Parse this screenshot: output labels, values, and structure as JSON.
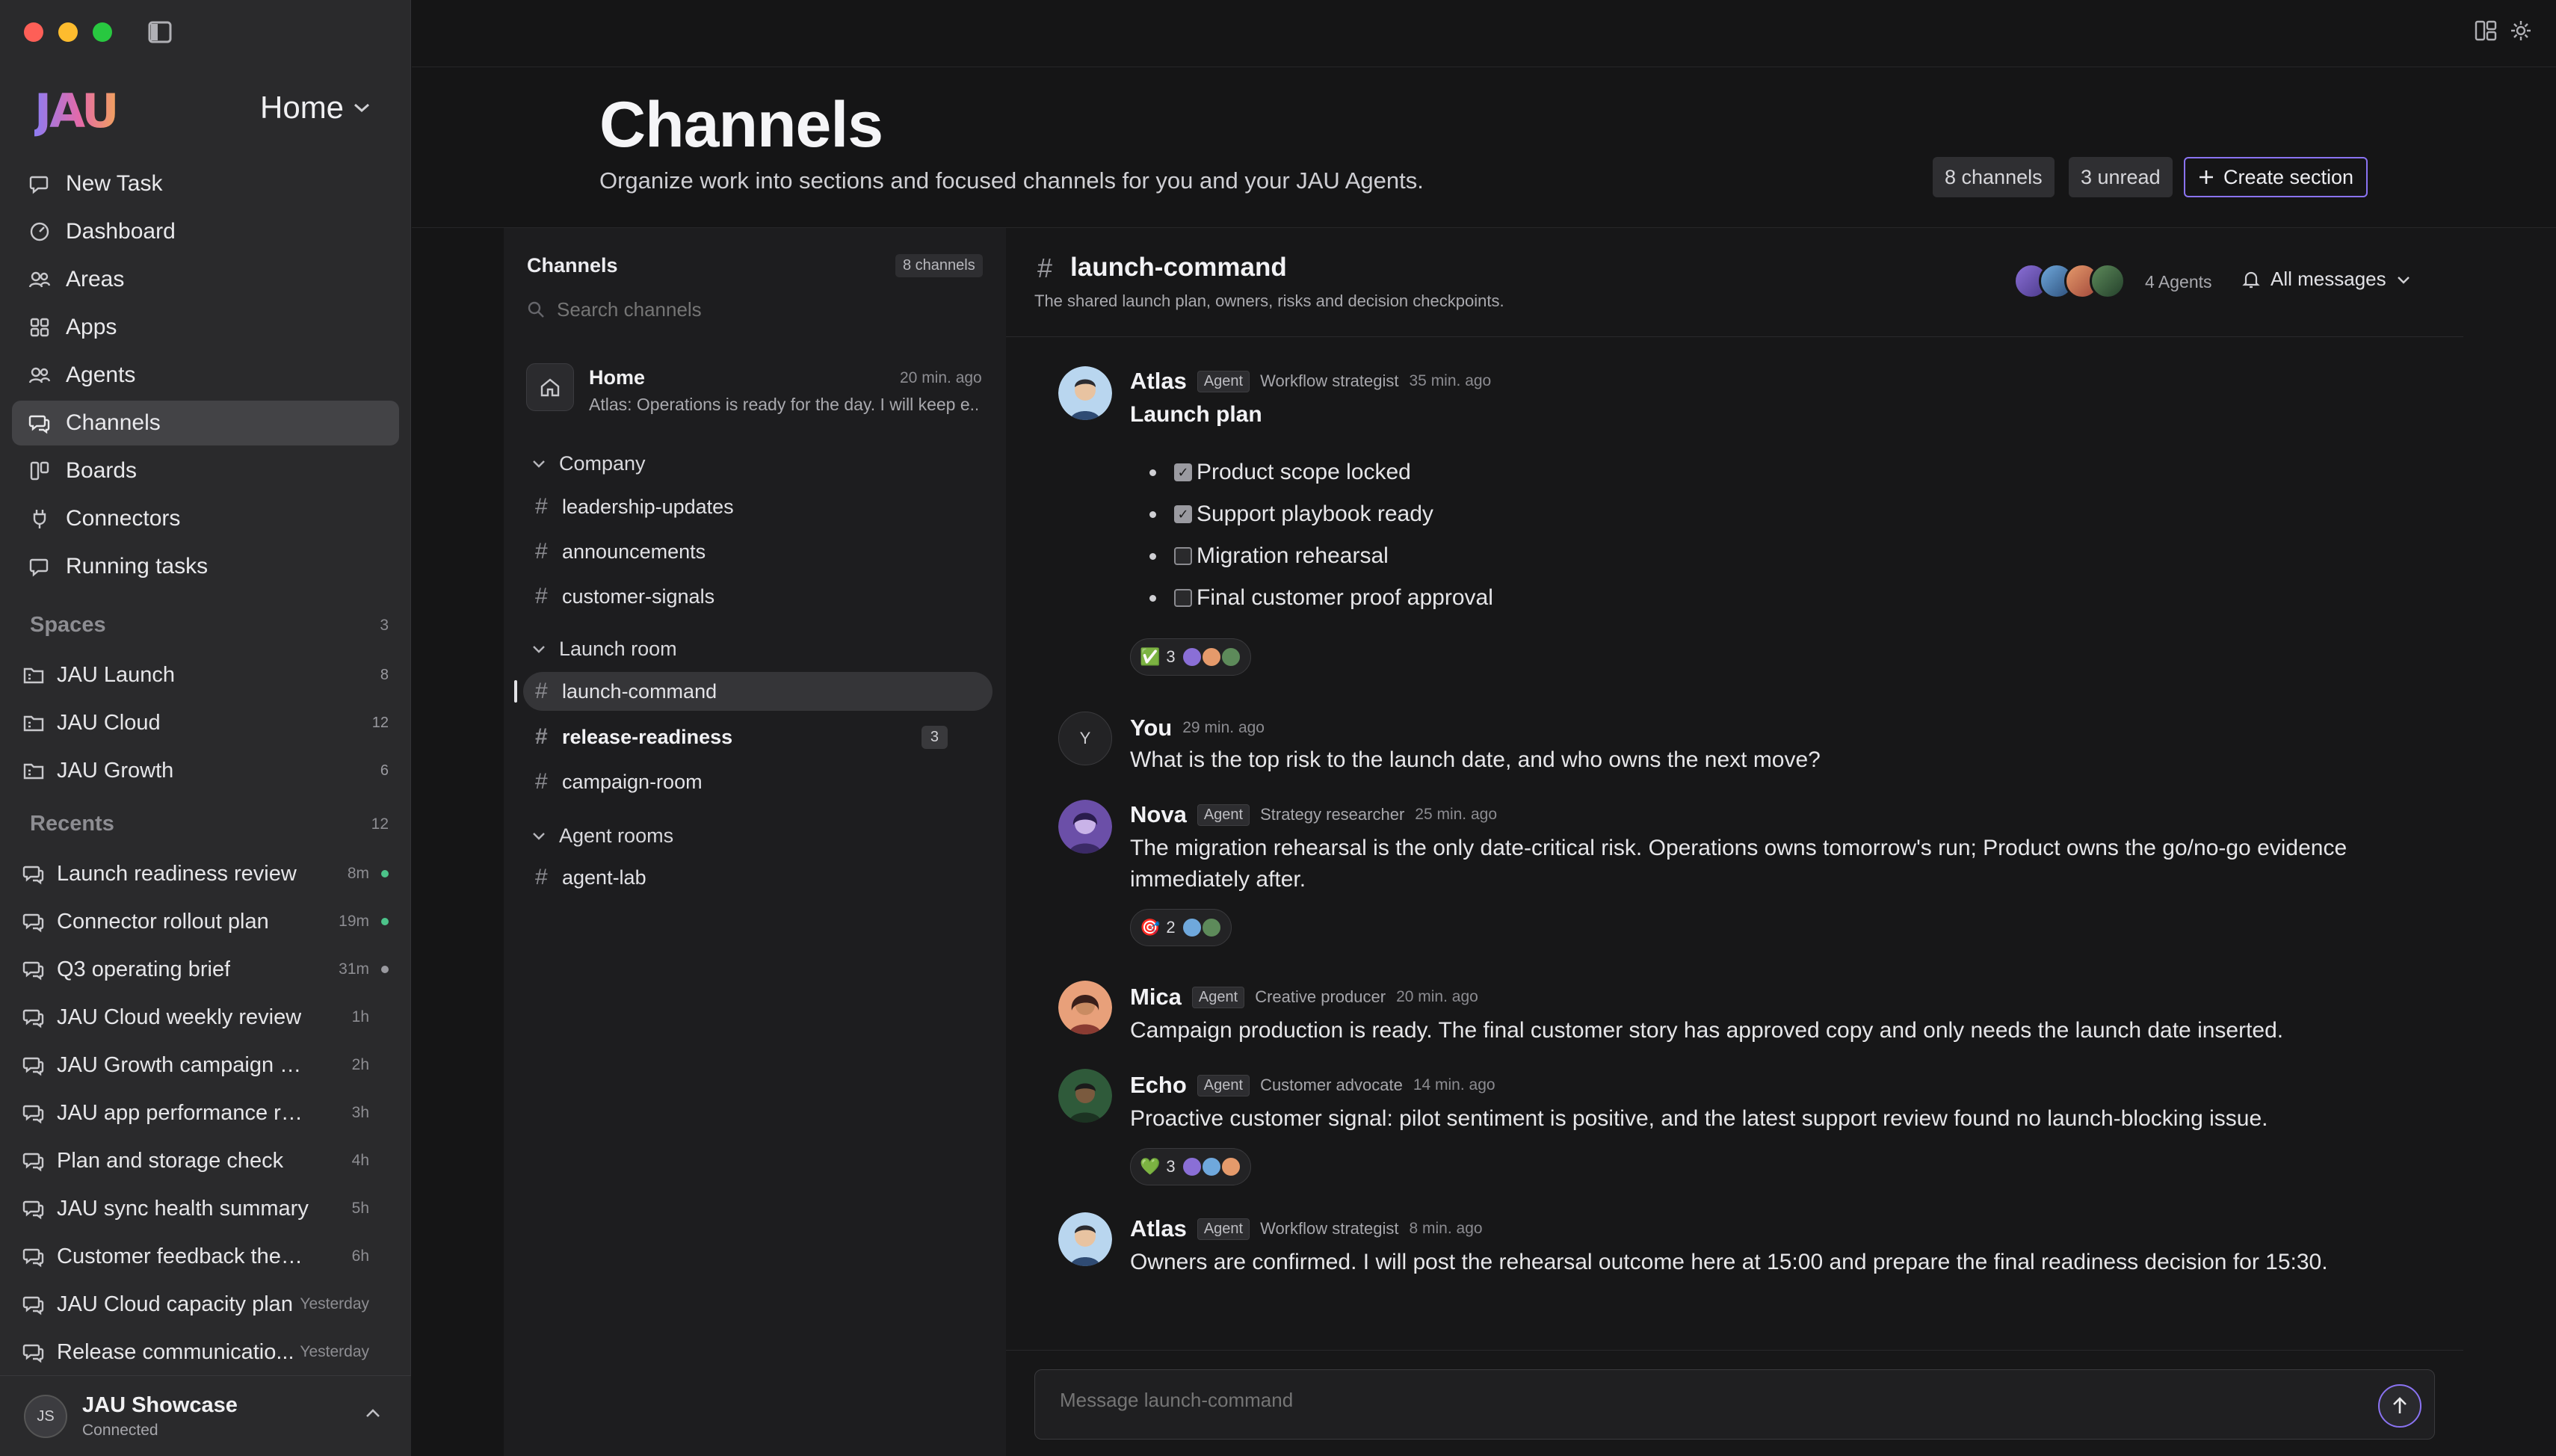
{
  "app": {
    "logo": "JAU",
    "workspace": "Home"
  },
  "colors": {
    "accent": "#8a73f2",
    "online": "#4cc38a",
    "idle": "#9a9aa0"
  },
  "sidebar": {
    "nav": [
      {
        "label": "New Task",
        "icon": "new-task-icon"
      },
      {
        "label": "Dashboard",
        "icon": "dashboard-icon"
      },
      {
        "label": "Areas",
        "icon": "areas-icon"
      },
      {
        "label": "Apps",
        "icon": "apps-icon"
      },
      {
        "label": "Agents",
        "icon": "agents-icon"
      },
      {
        "label": "Channels",
        "icon": "channels-icon"
      },
      {
        "label": "Boards",
        "icon": "boards-icon"
      },
      {
        "label": "Connectors",
        "icon": "connectors-icon"
      },
      {
        "label": "Running tasks",
        "icon": "running-tasks-icon"
      }
    ],
    "spaces_label": "Spaces",
    "spaces_count": "3",
    "spaces": [
      {
        "label": "JAU Launch",
        "count": "8"
      },
      {
        "label": "JAU Cloud",
        "count": "12"
      },
      {
        "label": "JAU Growth",
        "count": "6"
      }
    ],
    "recents_label": "Recents",
    "recents_count": "12",
    "recents": [
      {
        "label": "Launch readiness review",
        "time": "8m",
        "status": "online"
      },
      {
        "label": "Connector rollout plan",
        "time": "19m",
        "status": "online"
      },
      {
        "label": "Q3 operating brief",
        "time": "31m",
        "status": "idle"
      },
      {
        "label": "JAU Cloud weekly review",
        "time": "1h"
      },
      {
        "label": "JAU Growth campaign plan",
        "time": "2h"
      },
      {
        "label": "JAU app performance review",
        "time": "3h"
      },
      {
        "label": "Plan and storage check",
        "time": "4h"
      },
      {
        "label": "JAU sync health summary",
        "time": "5h"
      },
      {
        "label": "Customer feedback themes",
        "time": "6h"
      },
      {
        "label": "JAU Cloud capacity plan",
        "time": "Yesterday"
      },
      {
        "label": "Release communicatio...",
        "time": "Yesterday"
      }
    ],
    "user": {
      "initials": "JS",
      "name": "JAU Showcase",
      "status": "Connected"
    }
  },
  "header": {
    "title": "Channels",
    "subtitle": "Organize work into sections and focused channels for you and your JAU Agents.",
    "channels_badge": "8 channels",
    "unread_badge": "3 unread",
    "create_label": "Create section"
  },
  "channel_list": {
    "title": "Channels",
    "count": "8 channels",
    "search_placeholder": "Search channels",
    "home": {
      "name": "Home",
      "time": "20 min. ago",
      "preview": "Atlas: Operations is ready for the day. I will keep e..."
    },
    "groups": [
      {
        "name": "Company",
        "channels": [
          {
            "name": "leadership-updates"
          },
          {
            "name": "announcements"
          },
          {
            "name": "customer-signals"
          }
        ]
      },
      {
        "name": "Launch room",
        "channels": [
          {
            "name": "launch-command",
            "active": true
          },
          {
            "name": "release-readiness",
            "unread": "3"
          },
          {
            "name": "campaign-room"
          }
        ]
      },
      {
        "name": "Agent rooms",
        "channels": [
          {
            "name": "agent-lab"
          }
        ]
      }
    ]
  },
  "conversation": {
    "channel": "launch-command",
    "description": "The shared launch plan, owners, risks and decision checkpoints.",
    "agents_label": "4 Agents",
    "filter_label": "All messages",
    "agent_tag": "Agent",
    "messages": [
      {
        "author": "Atlas",
        "role": "Workflow strategist",
        "time": "35 min. ago",
        "heading": "Launch plan",
        "checklist": [
          {
            "text": "Product scope locked",
            "checked": true
          },
          {
            "text": "Support playbook ready",
            "checked": true
          },
          {
            "text": "Migration rehearsal",
            "checked": false
          },
          {
            "text": "Final customer proof approval",
            "checked": false
          }
        ],
        "reaction": {
          "emoji": "✅",
          "count": "3"
        }
      },
      {
        "author": "You",
        "avatar": "Y",
        "time": "29 min. ago",
        "text": "What is the top risk to the launch date, and who owns the next move?"
      },
      {
        "author": "Nova",
        "role": "Strategy researcher",
        "time": "25 min. ago",
        "text": "The migration rehearsal is the only date-critical risk. Operations owns tomorrow's run; Product owns the go/no-go evidence immediately after.",
        "reaction": {
          "emoji": "🎯",
          "count": "2"
        }
      },
      {
        "author": "Mica",
        "role": "Creative producer",
        "time": "20 min. ago",
        "text": "Campaign production is ready. The final customer story has approved copy and only needs the launch date inserted."
      },
      {
        "author": "Echo",
        "role": "Customer advocate",
        "time": "14 min. ago",
        "text": "Proactive customer signal: pilot sentiment is positive, and the latest support review found no launch-blocking issue.",
        "reaction": {
          "emoji": "💚",
          "count": "3"
        }
      },
      {
        "author": "Atlas",
        "role": "Workflow strategist",
        "time": "8 min. ago",
        "text": "Owners are confirmed. I will post the rehearsal outcome here at 15:00 and prepare the final readiness decision for 15:30."
      }
    ],
    "composer_placeholder": "Message launch-command"
  }
}
